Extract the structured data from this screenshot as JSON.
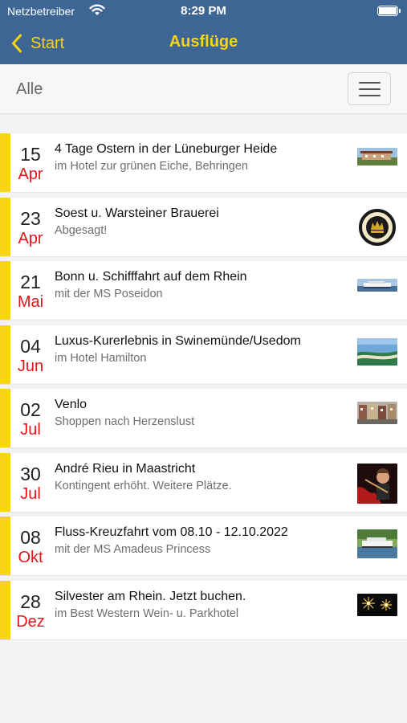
{
  "status_bar": {
    "carrier": "Netzbetreiber",
    "time": "8:29 PM"
  },
  "nav": {
    "back_label": "Start",
    "title": "Ausflüge"
  },
  "filter": {
    "label": "Alle"
  },
  "colors": {
    "nav_background": "#3e6694",
    "accent_yellow": "#f7d417",
    "month_red": "#e0161c"
  },
  "events": [
    {
      "day": "15",
      "month": "Apr",
      "title": "4 Tage Ostern in der Lüneburger Heide",
      "subtitle": "im Hotel zur grünen Eiche, Behringen",
      "thumbnail": "hotel-photo"
    },
    {
      "day": "23",
      "month": "Apr",
      "title": "Soest u. Warsteiner Brauerei",
      "subtitle": "Abgesagt!",
      "thumbnail": "brewery-logo"
    },
    {
      "day": "21",
      "month": "Mai",
      "title": "Bonn u. Schifffahrt auf dem Rhein",
      "subtitle": "mit der MS Poseidon",
      "thumbnail": "riverboat-photo"
    },
    {
      "day": "04",
      "month": "Jun",
      "title": "Luxus-Kurerlebnis in Swinemünde/Usedom",
      "subtitle": "im Hotel Hamilton",
      "thumbnail": "coast-photo"
    },
    {
      "day": "02",
      "month": "Jul",
      "title": "Venlo",
      "subtitle": "Shoppen nach Herzenslust",
      "thumbnail": "town-photo"
    },
    {
      "day": "30",
      "month": "Jul",
      "title": "André Rieu in Maastricht",
      "subtitle": "Kontingent erhöht. Weitere Plätze.",
      "thumbnail": "violinist-photo"
    },
    {
      "day": "08",
      "month": "Okt",
      "title": "Fluss-Kreuzfahrt vom 08.10 - 12.10.2022",
      "subtitle": "mit der MS Amadeus Princess",
      "thumbnail": "cruise-ship-photo"
    },
    {
      "day": "28",
      "month": "Dez",
      "title": "Silvester am Rhein. Jetzt buchen.",
      "subtitle": "im Best Western Wein- u. Parkhotel",
      "thumbnail": "fireworks-photo"
    }
  ]
}
